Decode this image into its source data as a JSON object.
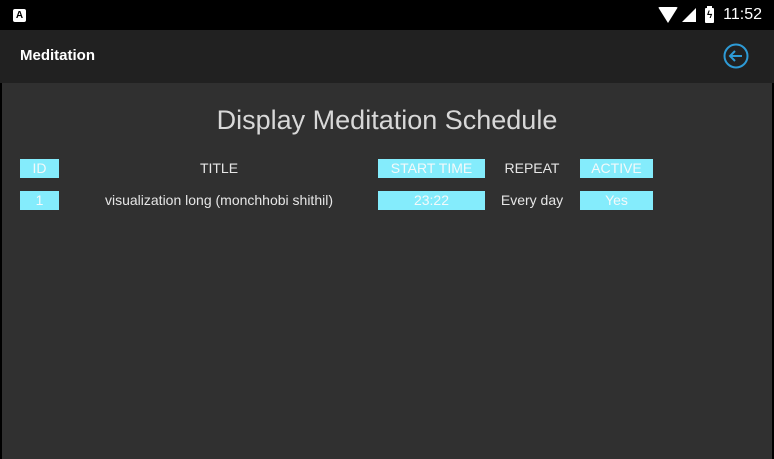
{
  "status_bar": {
    "notification_letter": "A",
    "time": "11:52"
  },
  "app_bar": {
    "title": "Meditation"
  },
  "page": {
    "title": "Display Meditation Schedule"
  },
  "table": {
    "headers": {
      "id": "ID",
      "title": "TITLE",
      "start_time": "START TIME",
      "repeat": "REPEAT",
      "active": "ACTIVE"
    },
    "rows": [
      {
        "id": "1",
        "title": "visualization long (monchhobi shithil)",
        "start_time": "23:22",
        "repeat": "Every day",
        "active": "Yes"
      }
    ]
  },
  "colors": {
    "highlight": "#84ecfc",
    "accent": "#2e9bd6",
    "background": "#303030",
    "app_bar": "#212121"
  }
}
